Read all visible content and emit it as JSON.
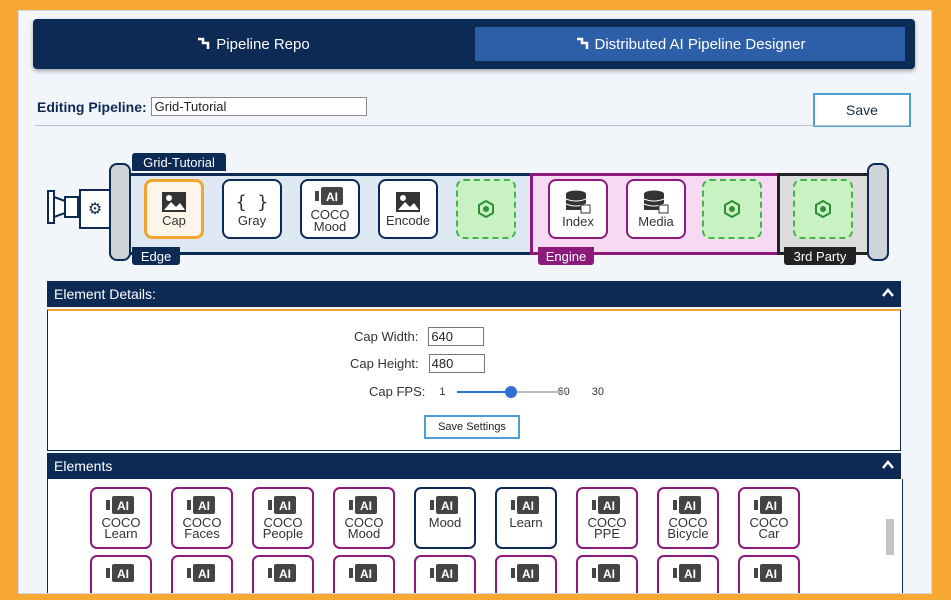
{
  "tabs": [
    {
      "label": "Pipeline Repo"
    },
    {
      "label": "Distributed AI Pipeline Designer"
    }
  ],
  "editing": {
    "label": "Editing Pipeline:",
    "value": "Grid-Tutorial"
  },
  "save_label": "Save",
  "pipeline": {
    "title": "Grid-Tutorial",
    "segments": {
      "edge": "Edge",
      "engine": "Engine",
      "third": "3rd Party"
    },
    "nodes": {
      "cap": "Cap",
      "gray": "Gray",
      "coco_mood_1": "COCO",
      "coco_mood_2": "Mood",
      "encode": "Encode",
      "index": "Index",
      "media": "Media"
    }
  },
  "details": {
    "title": "Element Details:",
    "cap_width_label": "Cap Width:",
    "cap_width": "640",
    "cap_height_label": "Cap Height:",
    "cap_height": "480",
    "cap_fps_label": "Cap FPS:",
    "fps_min": "1",
    "fps_max": "60",
    "fps_value": "30",
    "fps_fraction": 0.49,
    "save_settings": "Save Settings"
  },
  "elements": {
    "title": "Elements",
    "row1": [
      {
        "l1": "COCO",
        "l2": "Learn",
        "color": "purple"
      },
      {
        "l1": "COCO",
        "l2": "Faces",
        "color": "purple"
      },
      {
        "l1": "COCO",
        "l2": "People",
        "color": "purple"
      },
      {
        "l1": "COCO",
        "l2": "Mood",
        "color": "purple"
      },
      {
        "l1": "Mood",
        "l2": "",
        "color": "blue"
      },
      {
        "l1": "Learn",
        "l2": "",
        "color": "blue"
      },
      {
        "l1": "COCO",
        "l2": "PPE",
        "color": "purple"
      },
      {
        "l1": "COCO",
        "l2": "Bicycle",
        "color": "purple"
      },
      {
        "l1": "COCO",
        "l2": "Car",
        "color": "purple"
      }
    ]
  },
  "colors": {
    "navy": "#0d2a55",
    "accent": "#f2a531",
    "engine": "#8b1a7a",
    "placeholder_green": "#c9f2c4"
  },
  "icons": [
    "pipeline-icon",
    "gear-icon",
    "image-icon",
    "braces-icon",
    "ai-camera-icon",
    "database-lock-icon",
    "hexagon-icon",
    "chevron-up-icon"
  ]
}
